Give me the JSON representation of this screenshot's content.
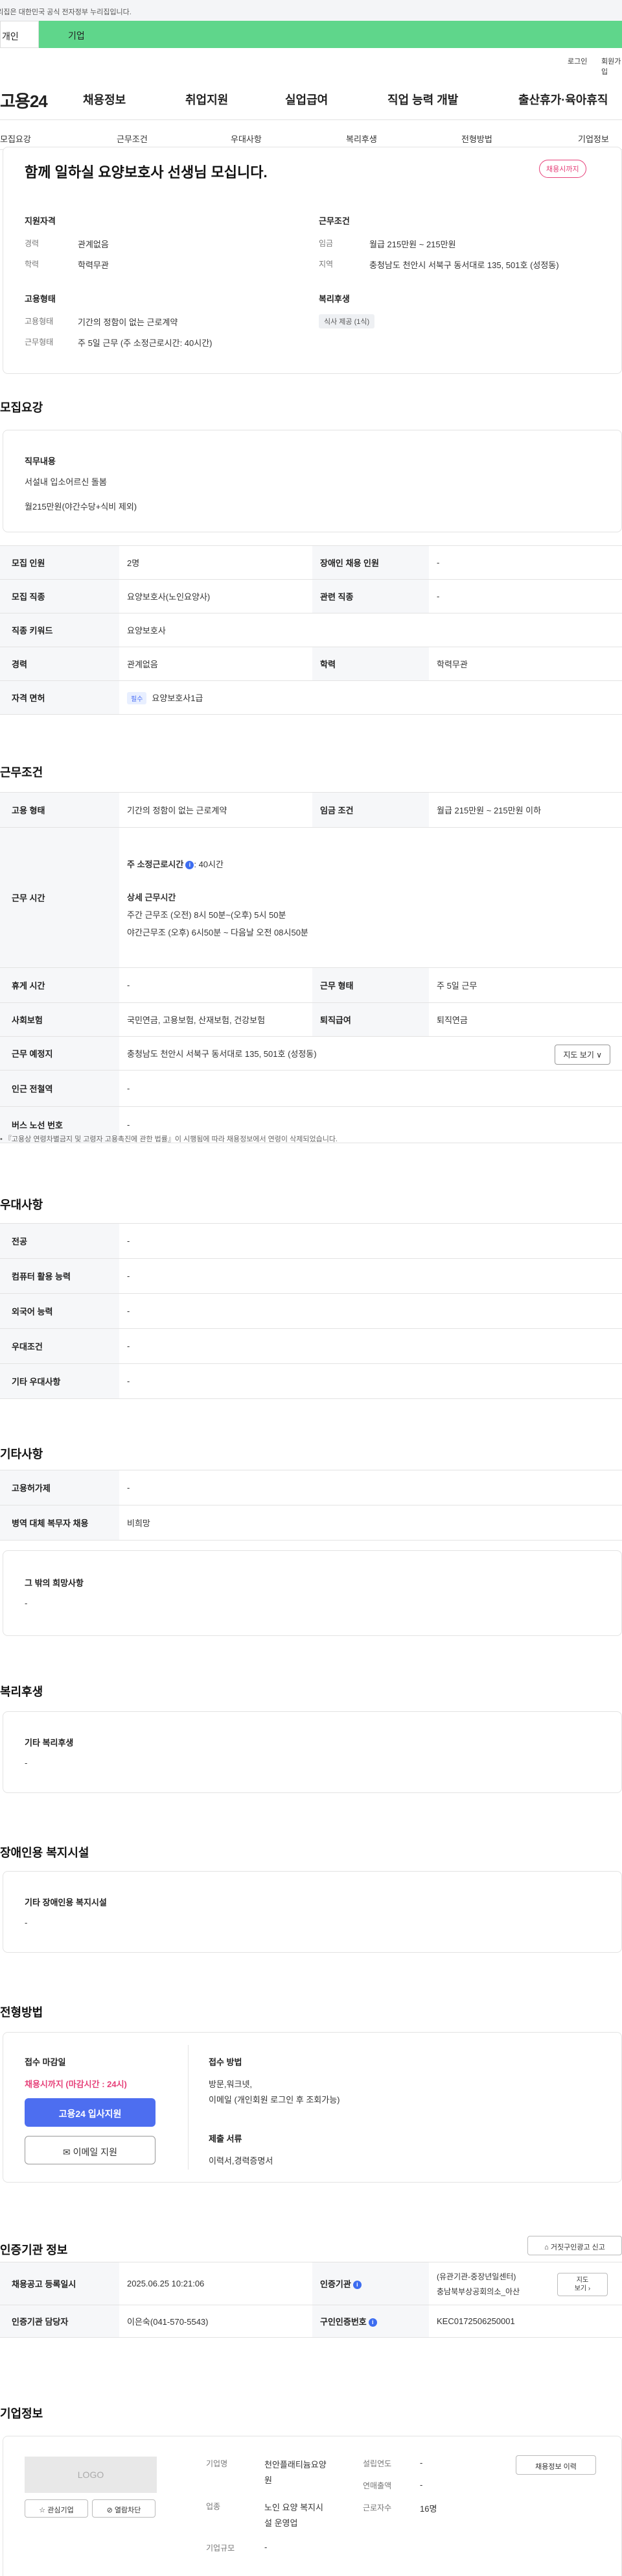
{
  "gov_banner": "이 누리집은 대한민국 공식 전자정부 누리집입니다.",
  "top_tabs": {
    "personal": "개인",
    "company": "기업"
  },
  "util": {
    "login": "로그인",
    "signup": "회원가입"
  },
  "logo": "고용24",
  "gnb": [
    "채용정보",
    "취업지원",
    "실업급여",
    "직업 능력 개발",
    "출산휴가·육아휴직"
  ],
  "subnav": [
    "모집요강",
    "근무조건",
    "우대사항",
    "복리후생",
    "전형방법",
    "기업정보"
  ],
  "job": {
    "title": "함께 일하실 요양보호사 선생님 모십니다.",
    "deadline_badge": "채용시까지",
    "qual_heading": "지원자격",
    "career_label": "경력",
    "career_value": "관계없음",
    "edu_label": "학력",
    "edu_value": "학력무관",
    "cond_heading": "근무조건",
    "wage_label": "임금",
    "wage_value": "월급 215만원 ~ 215만원",
    "region_label": "지역",
    "region_value": "충청남도 천안시 서북구 동서대로 135, 501호 (성정동)",
    "emp_heading": "고용형태",
    "emp_type_label": "고용형태",
    "emp_type_value": "기간의 정함이 없는 근로계약",
    "work_form_label": "근무형태",
    "work_form_value": "주 5일 근무 (주 소정근로시간: 40시간)",
    "welfare_heading": "복리후생",
    "welfare_tag": "식사 제공 (1식)"
  },
  "recruit": {
    "section_title": "모집요강",
    "duty_heading": "직무내용",
    "duty_line1": "서설내 입소어르신 돌봄",
    "duty_line2": "월215만원(야간수당+식비 제외)",
    "rows": {
      "headcount_label": "모집 인원",
      "headcount_value": "2명",
      "disabled_label": "장애인 채용 인원",
      "disabled_value": "-",
      "job_label": "모집 직종",
      "job_value": "요양보호사(노인요양사)",
      "related_label": "관련 직종",
      "related_value": "-",
      "keyword_label": "직종 키워드",
      "keyword_value": "요양보호사",
      "career_label": "경력",
      "career_value": "관계없음",
      "edu_label": "학력",
      "edu_value": "학력무관",
      "license_label": "자격 면허",
      "license_tag": "필수",
      "license_value": "요양보호사1급"
    }
  },
  "work": {
    "section_title": "근무조건",
    "emp_label": "고용 형태",
    "emp_value": "기간의 정함이 없는 근로계약",
    "wage_label": "임금 조건",
    "wage_value": "월급 215만원 ~ 215만원 이하",
    "hours_label": "근무 시간",
    "weekly_hours_label": "주 소정근로시간",
    "weekly_hours_value": ": 40시간",
    "detail_heading": "상세 근무시간",
    "detail_day": "주간 근무조 (오전) 8시 50분~(오후) 5시 50분",
    "detail_night": "야간근무조 (오후) 6시50분 ~ 다음날 오전 08시50분",
    "break_label": "휴게 시간",
    "break_value": "-",
    "form_label": "근무 형태",
    "form_value": "주 5일 근무",
    "insurance_label": "사회보험",
    "insurance_value": "국민연금, 고용보험, 산재보험, 건강보험",
    "retire_label": "퇴직급여",
    "retire_value": "퇴직연금",
    "place_label": "근무 예정지",
    "place_value": "충청남도 천안시 서북구 동서대로 135, 501호 (성정동)",
    "map_btn": "지도 보기 ∨",
    "subway_label": "인근 전철역",
    "subway_value": "-",
    "bus_label": "버스 노선 번호",
    "bus_value": "-",
    "note": "『고용상 연령차별금지 및 고령자 고용촉진에 관한 법률』이 시행됨에 따라 채용정보에서 연령이 삭제되었습니다."
  },
  "pref": {
    "section_title": "우대사항",
    "major_label": "전공",
    "major_value": "-",
    "computer_label": "컴퓨터 활용 능력",
    "computer_value": "-",
    "lang_label": "외국어 능력",
    "lang_value": "-",
    "cond_label": "우대조건",
    "cond_value": "-",
    "etc_label": "기타 우대사항",
    "etc_value": "-"
  },
  "other": {
    "section_title": "기타사항",
    "emp_permit_label": "고용허가제",
    "emp_permit_value": "-",
    "military_label": "병역 대체 복무자 채용",
    "military_value": "비희망",
    "wish_heading": "그 밖의 희망사항",
    "wish_value": "-"
  },
  "welfare": {
    "section_title": "복리후생",
    "heading": "기타 복리후생",
    "value": "-"
  },
  "disabled_fac": {
    "section_title": "장애인용 복지시설",
    "heading": "기타 장애인용 복지시설",
    "value": "-"
  },
  "selection": {
    "section_title": "전형방법",
    "deadline_heading": "접수 마감일",
    "deadline_value": "채용시까지 (마감시간 : 24시)",
    "apply_btn": "고용24 입사지원",
    "email_btn": "이메일 지원",
    "method_heading": "접수 방법",
    "method_line1": "방문,워크넷,",
    "method_line2": "이메일 (개인회원 로그인 후 조회가능)",
    "docs_heading": "제출 서류",
    "docs_value": "이력서,경력증명서"
  },
  "cert": {
    "section_title": "인증기관 정보",
    "report_btn": "거짓구인광고 신고",
    "reg_label": "채용공고 등록일시",
    "reg_value": "2025.06.25 10:21:06",
    "agency_label": "인증기관",
    "agency_value_1": "(유관기관-중장년일센터)",
    "agency_value_2": "충남북부상공회의소_아산",
    "more_btn_1": "지도",
    "more_btn_2": "보기",
    "manager_label": "인증기관 담당자",
    "manager_value": "이은숙(041-570-5543)",
    "cert_no_label": "구인인증번호",
    "cert_no_value": "KEC0172506250001"
  },
  "company": {
    "section_title": "기업정보",
    "logo_text": "LOGO",
    "interest_btn": "☆ 관심기업",
    "block_btn": "⊘ 열람차단",
    "name_label": "기업명",
    "name_value_1": "천안플래티늄요양",
    "name_value_2": "원",
    "industry_label": "업종",
    "industry_value_1": "노인 요양 복지시",
    "industry_value_2": "설 운영업",
    "size_label": "기업규모",
    "size_value": "-",
    "founded_label": "설립연도",
    "founded_value": "-",
    "sales_label": "연매출액",
    "sales_value": "-",
    "staff_label": "근로자수",
    "staff_value": "16명",
    "history_btn": "채용정보 이력"
  },
  "colors": {
    "accent": "#4d6ef0",
    "company_tab": "#5fd68b",
    "deadline": "#e6427a"
  }
}
